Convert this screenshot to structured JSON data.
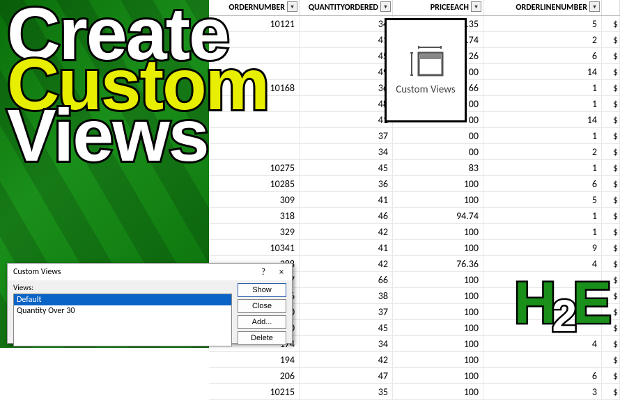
{
  "chart_data": {
    "type": "table",
    "columns": [
      "ORDERNUMBER",
      "QUANTITYORDERED",
      "PRICEEACH",
      "ORDERLINENUMBER"
    ],
    "rows": [
      [
        "10121",
        "34",
        "81.35",
        "5"
      ],
      [
        "",
        "41",
        "94.74",
        "2"
      ],
      [
        "",
        "45",
        "26",
        "6"
      ],
      [
        "",
        "49",
        "00",
        "14"
      ],
      [
        "10168",
        "36",
        "66",
        "1"
      ],
      [
        "",
        "48",
        "00",
        "1"
      ],
      [
        "",
        "41",
        "00",
        "14"
      ],
      [
        "",
        "37",
        "00",
        "1"
      ],
      [
        "",
        "34",
        "00",
        "2"
      ],
      [
        "10275",
        "45",
        "83",
        "1"
      ],
      [
        "10285",
        "36",
        "100",
        "6"
      ],
      [
        "309",
        "41",
        "100",
        "5"
      ],
      [
        "318",
        "46",
        "94.74",
        "1"
      ],
      [
        "329",
        "42",
        "100",
        "1"
      ],
      [
        "10341",
        "41",
        "100",
        "9"
      ],
      [
        "388",
        "42",
        "76.36",
        "4"
      ],
      [
        "417",
        "66",
        "100",
        ""
      ],
      [
        "126",
        "38",
        "100",
        ""
      ],
      [
        "140",
        "37",
        "100",
        ""
      ],
      [
        "150",
        "45",
        "100",
        ""
      ],
      [
        "174",
        "34",
        "100",
        "4"
      ],
      [
        "194",
        "42",
        "100",
        ""
      ],
      [
        "206",
        "47",
        "100",
        "6"
      ],
      [
        "10215",
        "35",
        "100",
        "3"
      ]
    ],
    "dollar_column": "$"
  },
  "cv_popup": {
    "label": "Custom Views"
  },
  "title": {
    "line1": "Create",
    "line2": "Custom",
    "line3": "Views"
  },
  "dialog": {
    "title": "Custom Views",
    "help": "?",
    "close": "×",
    "label": "Views:",
    "items": [
      "Default",
      "Quantity Over 30"
    ],
    "selected": 0,
    "buttons": {
      "show": "Show",
      "close": "Close",
      "add": "Add...",
      "delete": "Delete"
    }
  },
  "logo": {
    "h": "H",
    "n": "2",
    "e": "E"
  }
}
